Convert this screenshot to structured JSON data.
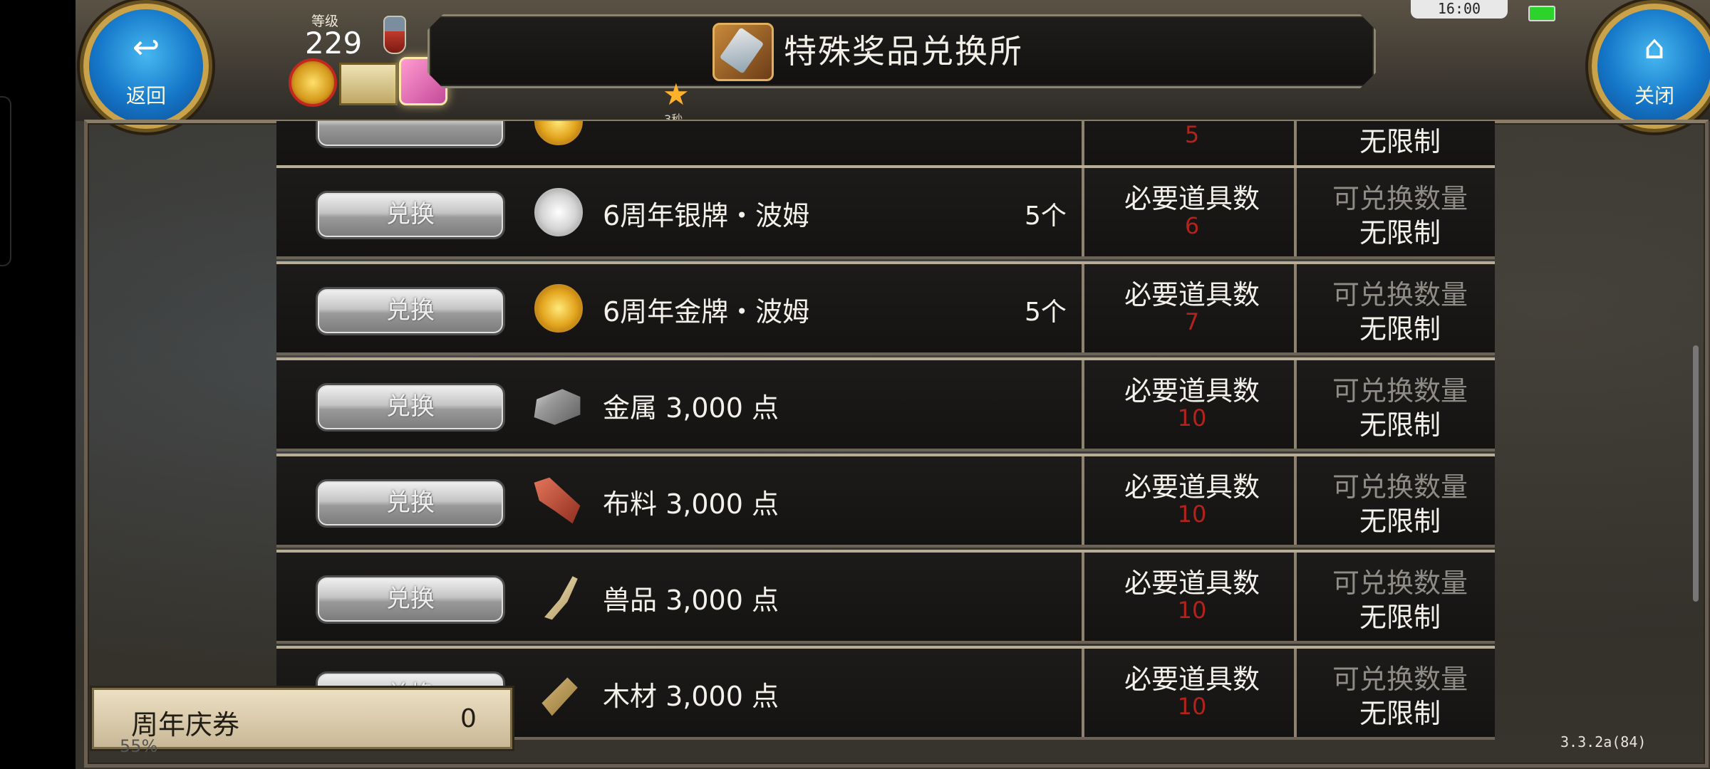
{
  "header": {
    "title": "特殊奖品兑换所",
    "back_label": "返回",
    "close_label": "关闭",
    "level_label": "等级",
    "level_value": "229",
    "time": "16:00",
    "star_sub": "3秒"
  },
  "items": [
    {
      "name": "",
      "qty": "",
      "req_label": "",
      "req_num": "5",
      "limit_label": "",
      "limit_value": "无限制",
      "icon": "medal-icon"
    },
    {
      "name": "6周年银牌・波姆",
      "qty": "5个",
      "req_label": "必要道具数",
      "req_num": "6",
      "limit_label": "可兑换数量",
      "limit_value": "无限制",
      "button": "兑换",
      "icon": "silver-medal-icon"
    },
    {
      "name": "6周年金牌・波姆",
      "qty": "5个",
      "req_label": "必要道具数",
      "req_num": "7",
      "limit_label": "可兑换数量",
      "limit_value": "无限制",
      "button": "兑换",
      "icon": "gold-medal-icon"
    },
    {
      "name": "金属 3,000 点",
      "qty": "",
      "req_label": "必要道具数",
      "req_num": "10",
      "limit_label": "可兑换数量",
      "limit_value": "无限制",
      "button": "兑换",
      "icon": "metal-ingot-icon"
    },
    {
      "name": "布料 3,000 点",
      "qty": "",
      "req_label": "必要道具数",
      "req_num": "10",
      "limit_label": "可兑换数量",
      "limit_value": "无限制",
      "button": "兑换",
      "icon": "cloth-icon"
    },
    {
      "name": "兽品 3,000 点",
      "qty": "",
      "req_label": "必要道具数",
      "req_num": "10",
      "limit_label": "可兑换数量",
      "limit_value": "无限制",
      "button": "兑换",
      "icon": "horn-icon"
    },
    {
      "name": "木材 3,000 点",
      "qty": "",
      "req_label": "必要道具数",
      "req_num": "10",
      "limit_label": "可兑换数量",
      "limit_value": "无限制",
      "button": "兑换",
      "icon": "wood-icon"
    }
  ],
  "coupon": {
    "label": "周年庆券",
    "value": "0"
  },
  "percent": "55%",
  "version": "3.3.2a(84)"
}
